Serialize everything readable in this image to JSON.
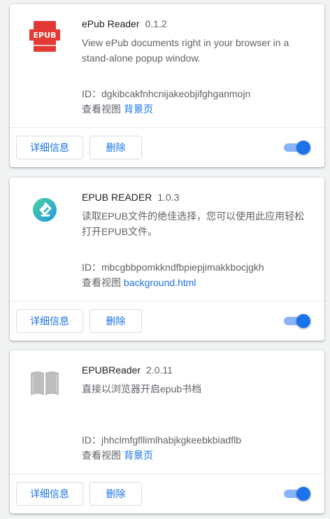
{
  "extensions": [
    {
      "name": "ePub Reader",
      "version": "0.1.2",
      "description": "View ePub documents right in your browser in a stand-alone popup window.",
      "id_text": "ID：dgkibcakfnhcnijakeobjifghganmojn",
      "views_label": "查看视图",
      "view_link": "背景页",
      "details_label": "详细信息",
      "remove_label": "删除",
      "icon": "epub-red-book-icon",
      "icon_text": "EPUB",
      "enabled": true
    },
    {
      "name": "EPUB READER",
      "version": "1.0.3",
      "description": "读取EPUB文件的绝佳选择，您可以使用此应用轻松打开EPUB文件。",
      "id_text": "ID：mbcgbbpomkkndfbpiepjimakkbocjgkh",
      "views_label": "查看视图",
      "view_link": "background.html",
      "details_label": "详细信息",
      "remove_label": "删除",
      "icon": "epub-reader-green-icon",
      "enabled": true
    },
    {
      "name": "EPUBReader",
      "version": "2.0.11",
      "description": "直接以浏览器开启epub书档",
      "id_text": "ID：jhhclmfgfllimlhabjkgkeebkbiadflb",
      "views_label": "查看视图",
      "view_link": "背景页",
      "details_label": "详细信息",
      "remove_label": "删除",
      "icon": "open-book-gray-icon",
      "enabled": true
    }
  ],
  "colors": {
    "accent": "#1a73e8",
    "toggle_track": "#8ab4f8",
    "epub_red": "#e53935",
    "epub_green": "#3ac47d",
    "book_gray": "#bdbdbd"
  }
}
